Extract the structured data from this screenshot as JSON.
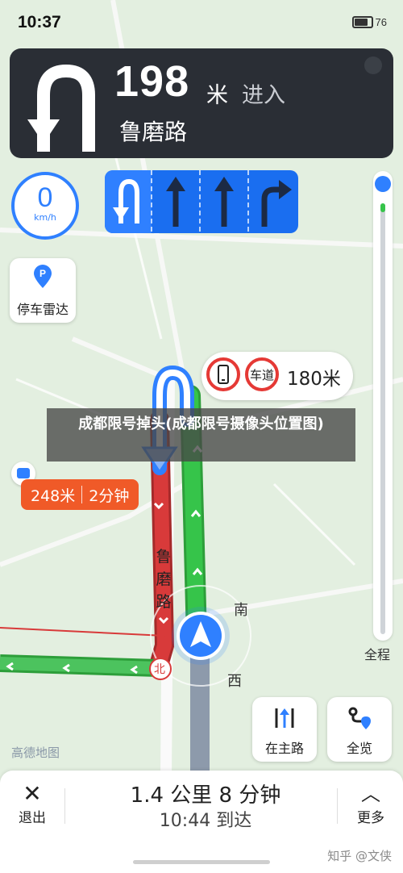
{
  "status_bar": {
    "time": "10:37",
    "battery": "76"
  },
  "guidance": {
    "distance": "198",
    "unit": "米",
    "action": "进入",
    "road": "鲁磨路",
    "maneuver_icon": "u-turn-icon"
  },
  "lanes": [
    {
      "icon": "u-turn-icon",
      "recommended": true
    },
    {
      "icon": "straight-arrow-icon",
      "recommended": false
    },
    {
      "icon": "straight-arrow-icon",
      "recommended": false
    },
    {
      "icon": "right-turn-arrow-icon",
      "recommended": false
    }
  ],
  "speed": {
    "value": "0",
    "unit": "km/h"
  },
  "parking_radar": {
    "label": "停车雷达"
  },
  "camera_alert": {
    "sign1": "phone-ban-icon",
    "sign2": "车道",
    "distance": "180米"
  },
  "route_label": {
    "distance": "248米",
    "time": "2分钟"
  },
  "banner": {
    "text": "成都限号掉头(成都限号摄像头位置图)"
  },
  "map_labels": {
    "road": "鲁磨路",
    "south": "南",
    "west": "西",
    "bei": "北",
    "logo": "高德地图"
  },
  "progress": {
    "completed_fraction": 0.02,
    "overview_label": "全程"
  },
  "buttons": {
    "main_road": "在主路",
    "overview": "全览"
  },
  "bottom": {
    "exit_label": "退出",
    "remaining": "1.4 公里 8 分钟",
    "arrival": "10:44 到达",
    "more_label": "更多"
  },
  "watermark": "知乎 @文侠",
  "colors": {
    "accent": "#2f80ff",
    "route_green": "#36c44a",
    "route_red": "#d83a3a",
    "panel": "#2a2e35",
    "alert": "#f05a28"
  }
}
